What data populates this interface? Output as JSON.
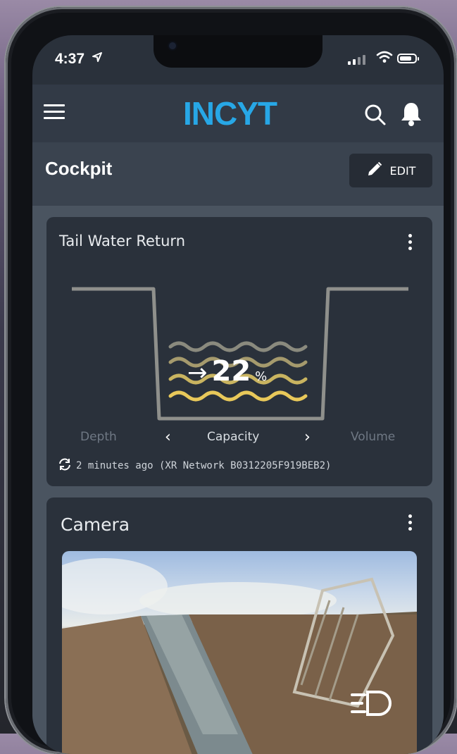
{
  "status_bar": {
    "time": "4:37",
    "location_icon": "navigation-arrow-icon"
  },
  "app_bar": {
    "logo": "INCYT",
    "menu_icon": "hamburger-icon",
    "search_icon": "search-icon",
    "notifications_icon": "bell-icon",
    "brand_color": "#27a7e6"
  },
  "page": {
    "title": "Cockpit",
    "edit_label": "EDIT"
  },
  "tail_water_card": {
    "title": "Tail Water Return",
    "value": "22",
    "unit": "%",
    "tabs": {
      "left": "Depth",
      "current": "Capacity",
      "right": "Volume"
    },
    "updated": "2 minutes ago (XR Network B0312205F919BEB2)"
  },
  "camera_card": {
    "title": "Camera"
  },
  "colors": {
    "wave_gold": "#e8c85a",
    "wave_mid": "#bca762",
    "wave_grey": "#8a8a7e"
  }
}
